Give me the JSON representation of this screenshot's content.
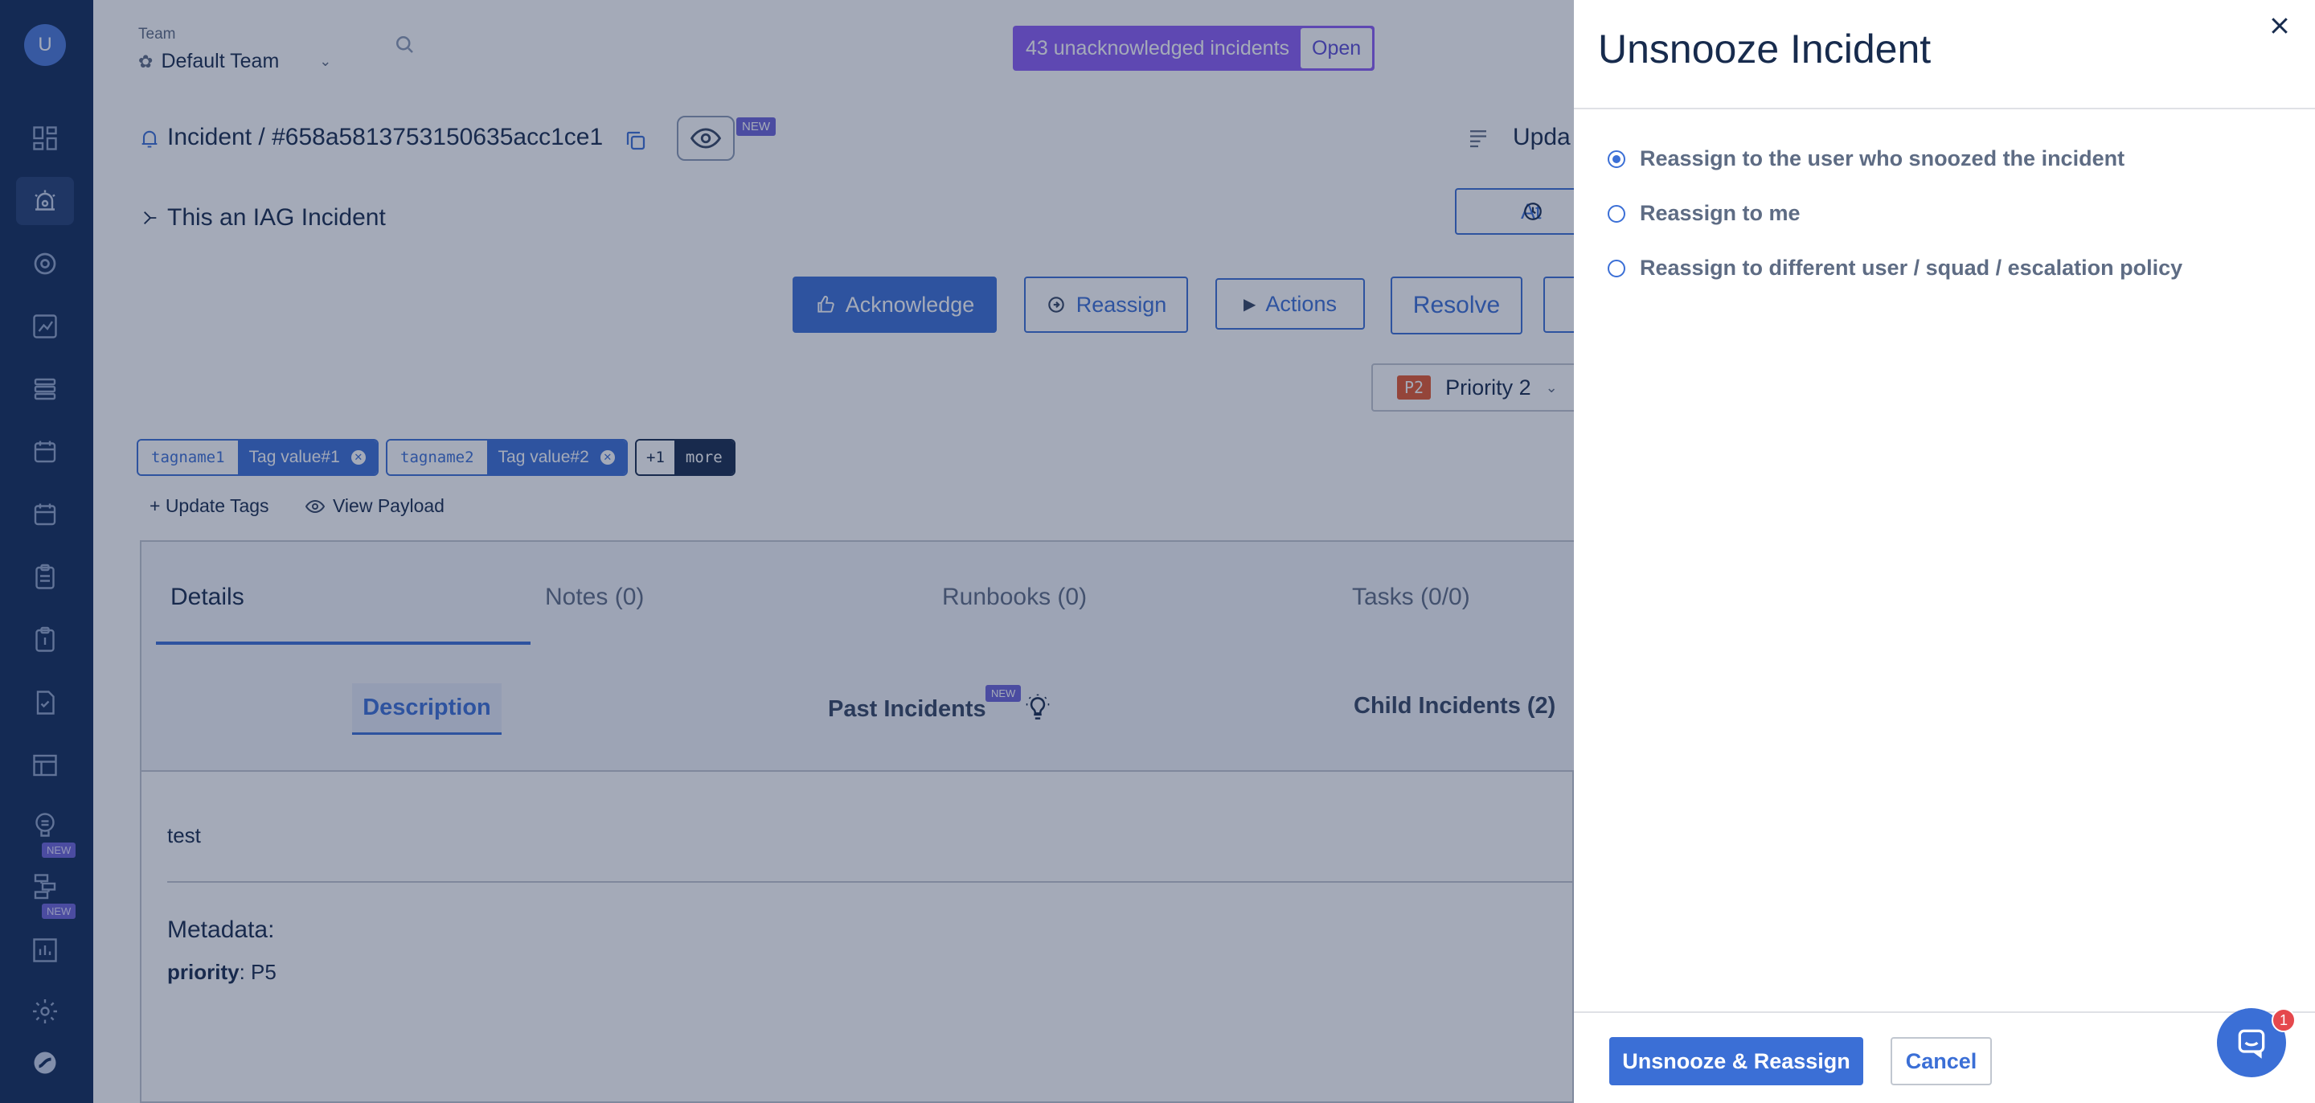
{
  "sidebar": {
    "avatar_initial": "U",
    "new_badge_1": "NEW",
    "new_badge_2": "NEW"
  },
  "header": {
    "team_label": "Team",
    "team_name": "Default Team",
    "banner_text": "43 unacknowledged incidents",
    "banner_action": "Open"
  },
  "incident": {
    "breadcrumb": "Incident / #658a5813753150635acc1ce1",
    "new_badge": "NEW",
    "title": "This an IAG Incident",
    "update_label": "Upda",
    "attach_label": "At"
  },
  "actions": {
    "acknowledge": "Acknowledge",
    "reassign": "Reassign",
    "actions": "Actions",
    "resolve": "Resolve"
  },
  "priority": {
    "code": "P2",
    "label": "Priority 2"
  },
  "tags": [
    {
      "key": "tagname1",
      "value": "Tag value#1"
    },
    {
      "key": "tagname2",
      "value": "Tag value#2"
    }
  ],
  "tags_more": {
    "count": "+1",
    "label": "more"
  },
  "links": {
    "update_tags": "+ Update Tags",
    "view_payload": "View Payload"
  },
  "tabs": [
    "Details",
    "Notes (0)",
    "Runbooks (0)",
    "Tasks (0/0)"
  ],
  "subtabs": {
    "description": "Description",
    "past_incidents": "Past Incidents",
    "past_new": "NEW",
    "child_incidents": "Child Incidents (2)"
  },
  "details": {
    "description_text": "test",
    "metadata_heading": "Metadata:",
    "metadata_key": "priority",
    "metadata_value": ": P5"
  },
  "drawer": {
    "title": "Unsnooze Incident",
    "options": [
      {
        "label": "Reassign to the user who snoozed the incident",
        "selected": true
      },
      {
        "label": "Reassign to me",
        "selected": false
      },
      {
        "label": "Reassign to different user / squad / escalation policy",
        "selected": false
      }
    ],
    "primary_button": "Unsnooze & Reassign",
    "cancel_button": "Cancel"
  },
  "chat": {
    "badge_count": "1"
  },
  "colors": {
    "sidebar": "#102a59",
    "accent": "#3b6fd6",
    "banner": "#8b5cf6",
    "priority_badge": "#e4572e"
  }
}
